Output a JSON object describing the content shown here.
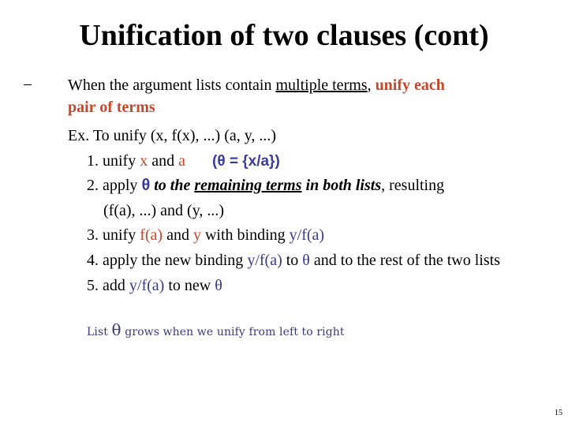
{
  "slide": {
    "title": "Unification of two clauses (cont)",
    "bullet_marker": "–",
    "bullet": {
      "part1": "When the argument lists contain ",
      "underlined": "multiple terms",
      "comma": ", ",
      "highlight_line1": "unify each",
      "highlight_line2": "pair of terms"
    },
    "example": "Ex. To unify (x, f(x), ...) (a, y, ...)",
    "steps": [
      {
        "num": "1. ",
        "t1": "unify ",
        "x": "x",
        "t2": " and ",
        "a": "a",
        "theta_expr": "(θ = {x/a})"
      },
      {
        "num": "2. ",
        "t1": "apply ",
        "theta": "θ",
        "i1": " to the ",
        "iu": "remaining terms",
        "i2": " in both lists",
        "t2": ", resulting",
        "cont": "(f(a), ...) and (y, ...)"
      },
      {
        "num": "3. ",
        "t1": "unify ",
        "fa": "f(a)",
        "t2": " and ",
        "y": "y",
        "t3": " with binding ",
        "binding": "y/f(a)"
      },
      {
        "num": "4. ",
        "t1": "apply the new binding ",
        "binding": "y/f(a)",
        "t2": " to ",
        "theta": "θ",
        "t3": " and to the rest of the two lists"
      },
      {
        "num": "5. ",
        "t1": "add ",
        "binding": "y/f(a)",
        "t2": " to new ",
        "theta": "θ"
      }
    ],
    "note": {
      "pre": "List ",
      "theta": "θ",
      "post": " grows when we unify from left to right"
    },
    "page_number": "15"
  }
}
